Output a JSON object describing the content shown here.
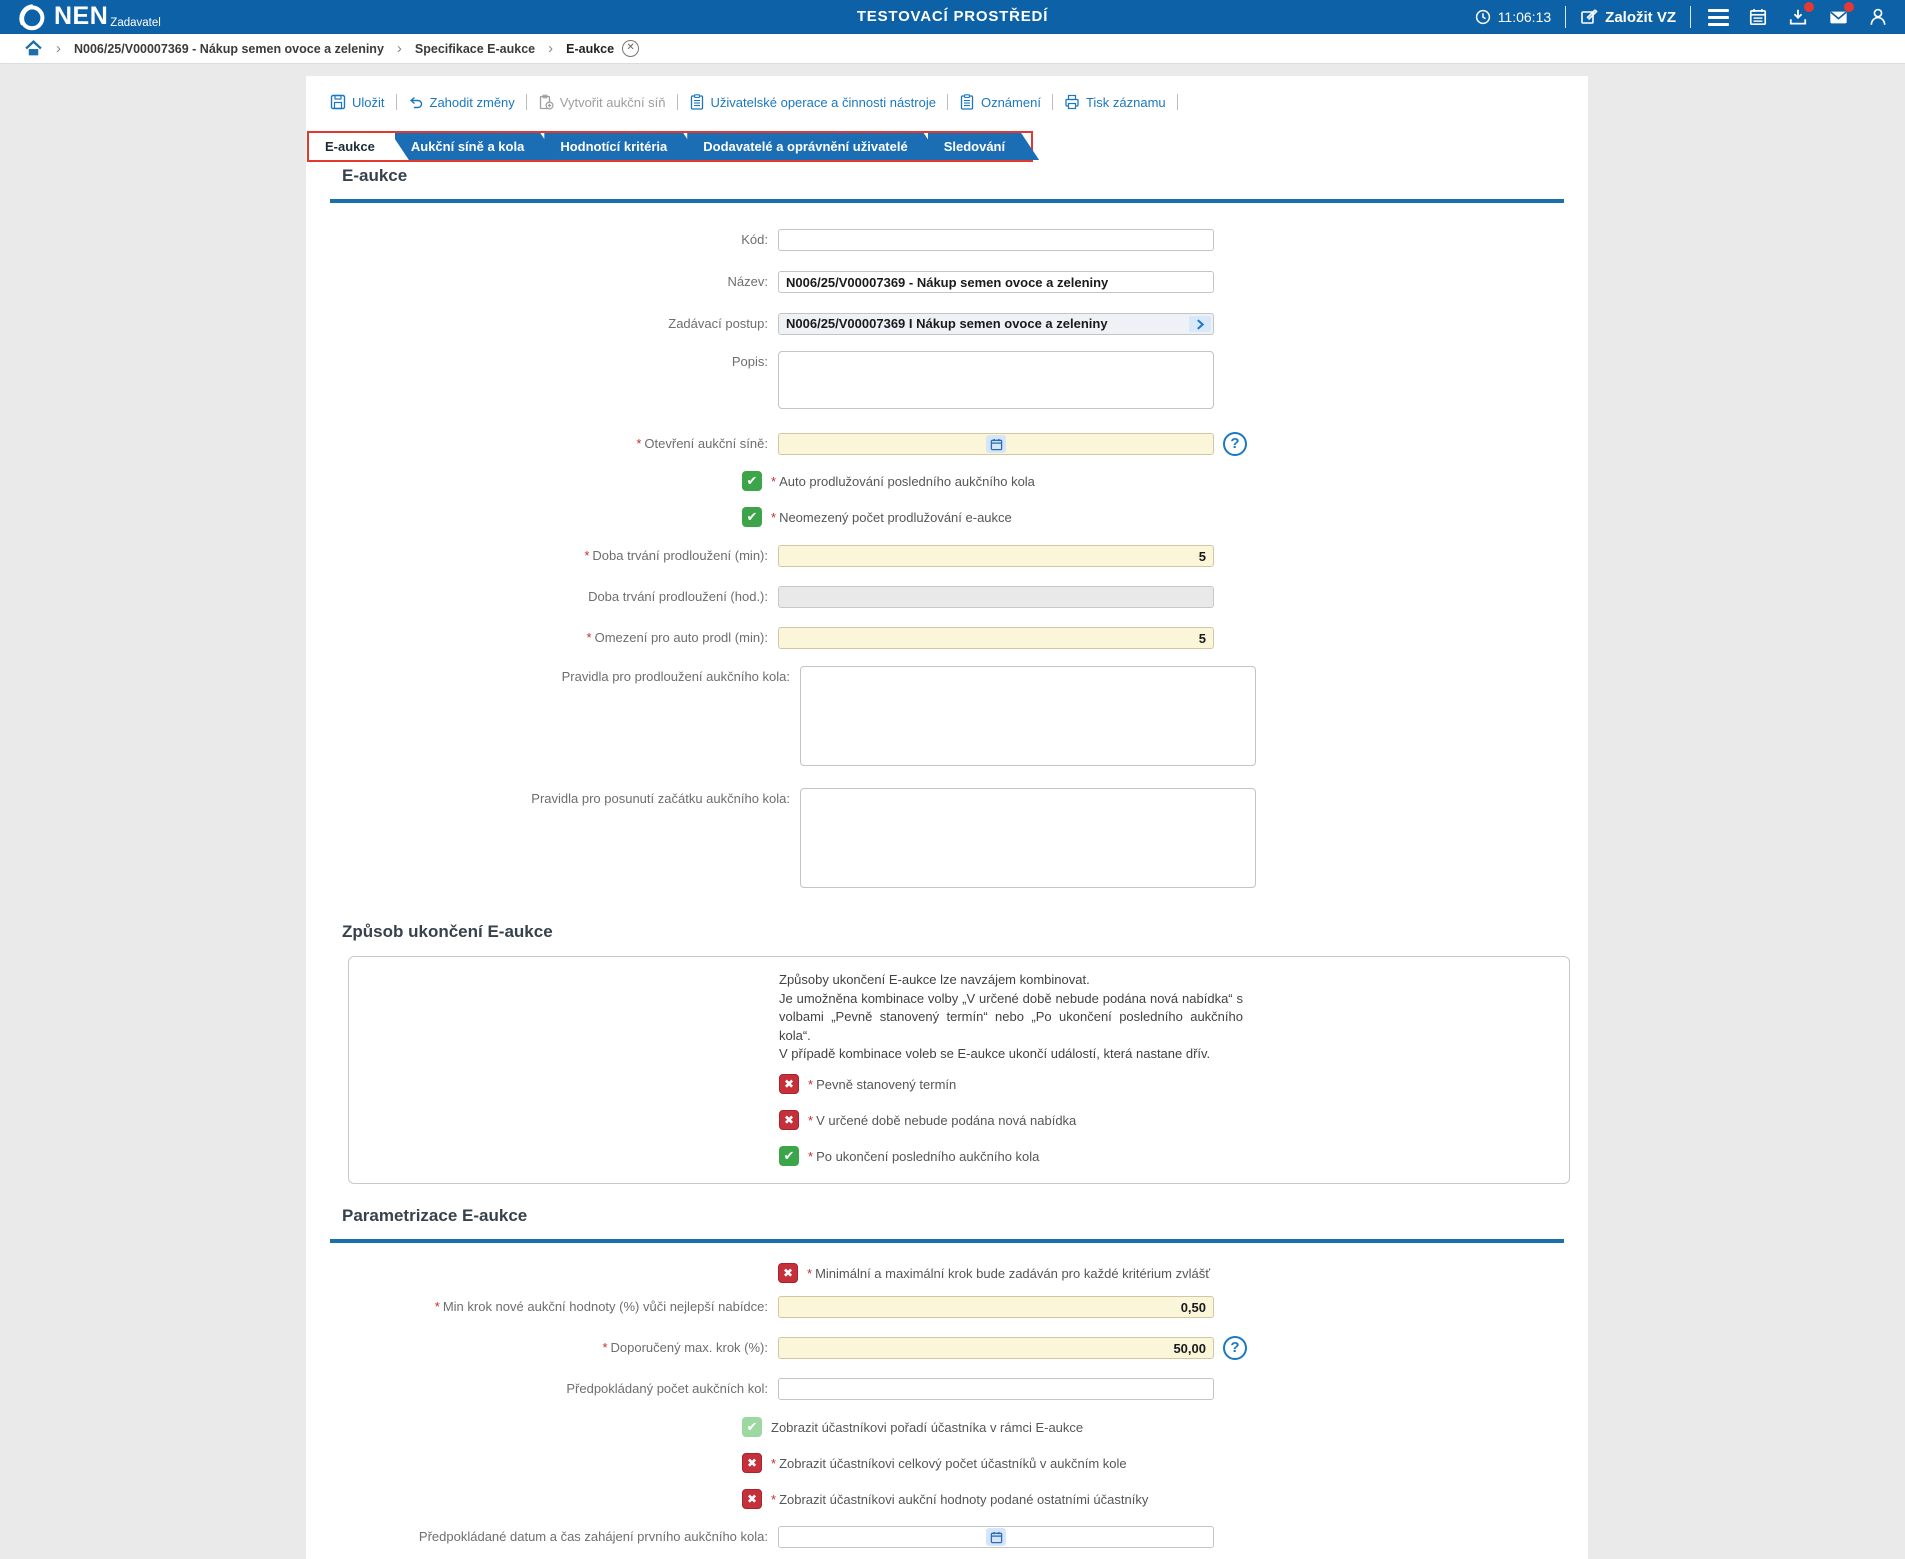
{
  "header": {
    "brand": "NEN",
    "brand_sub": "Zadavatel",
    "env": "TESTOVACÍ PROSTŘEDÍ",
    "time": "11:06:13",
    "create_vz": "Založit VZ"
  },
  "breadcrumb": {
    "item1": "N006/25/V00007369 - Nákup semen ovoce a zeleniny",
    "item2": "Specifikace E-aukce",
    "item3": "E-aukce"
  },
  "toolbar": {
    "save": "Uložit",
    "discard": "Zahodit změny",
    "create_room": "Vytvořit aukční síň",
    "user_ops": "Uživatelské operace a činnosti nástroje",
    "notices": "Oznámení",
    "print": "Tisk záznamu"
  },
  "tabs": {
    "t1": "E-aukce",
    "t2": "Aukční síně a kola",
    "t3": "Hodnotící kritéria",
    "t4": "Dodavatelé a oprávnění uživatelé",
    "t5": "Sledování"
  },
  "eaukce": {
    "title": "E-aukce",
    "kod_label": "Kód:",
    "nazev_label": "Název:",
    "nazev_value": "N006/25/V00007369 - Nákup semen ovoce a zeleniny",
    "postup_label": "Zadávací postup:",
    "postup_value": "N006/25/V00007369 I Nákup semen ovoce a zeleniny",
    "popis_label": "Popis:",
    "otevreni_label": "Otevření aukční síně:",
    "cb_auto": "Auto prodlužování posledního aukčního kola",
    "cb_neomezeny": "Neomezený počet prodlužování e-aukce",
    "doba_min_label": "Doba trvání prodloužení (min):",
    "doba_min_value": "5",
    "doba_hod_label": "Doba trvání prodloužení (hod.):",
    "omezeni_label": "Omezení pro auto prodl (min):",
    "omezeni_value": "5",
    "pravidla1_label": "Pravidla pro prodloužení aukčního kola:",
    "pravidla2_label": "Pravidla pro posunutí začátku aukčního kola:"
  },
  "zpusob": {
    "title": "Způsob ukončení E-aukce",
    "info1": "Způsoby ukončení E-aukce lze navzájem kombinovat.",
    "info2": "Je umožněna kombinace volby „V určené době nebude podána nová nabídka“ s volbami „Pevně stanovený termín“ nebo „Po ukončení posledního aukčního kola“.",
    "info3": "V případě kombinace voleb se E-aukce ukončí událostí, která nastane dřív.",
    "cb_termin": "Pevně stanovený termín",
    "cb_nabidka": "V určené době nebude podána nová nabídka",
    "cb_kolo": "Po ukončení posledního aukčního kola"
  },
  "parametrizace": {
    "title": "Parametrizace E-aukce",
    "cb_krok": "Minimální a maximální krok bude zadáván pro každé kritérium zvlášť",
    "min_krok_label": "Min krok nové aukční hodnoty (%) vůči nejlepší nabídce:",
    "min_krok_value": "0,50",
    "max_krok_label": "Doporučený max. krok (%):",
    "max_krok_value": "50,00",
    "pocet_label": "Předpokládaný počet aukčních kol:",
    "cb_poradi": "Zobrazit účastníkovi pořadí účastníka v rámci E-aukce",
    "cb_pocet": "Zobrazit účastníkovi celkový počet účastníků v aukčním kole",
    "cb_hodnoty": "Zobrazit účastníkovi aukční hodnoty podané ostatními účastníky",
    "datum_label": "Předpokládané datum a čas zahájení prvního aukčního kola:"
  }
}
